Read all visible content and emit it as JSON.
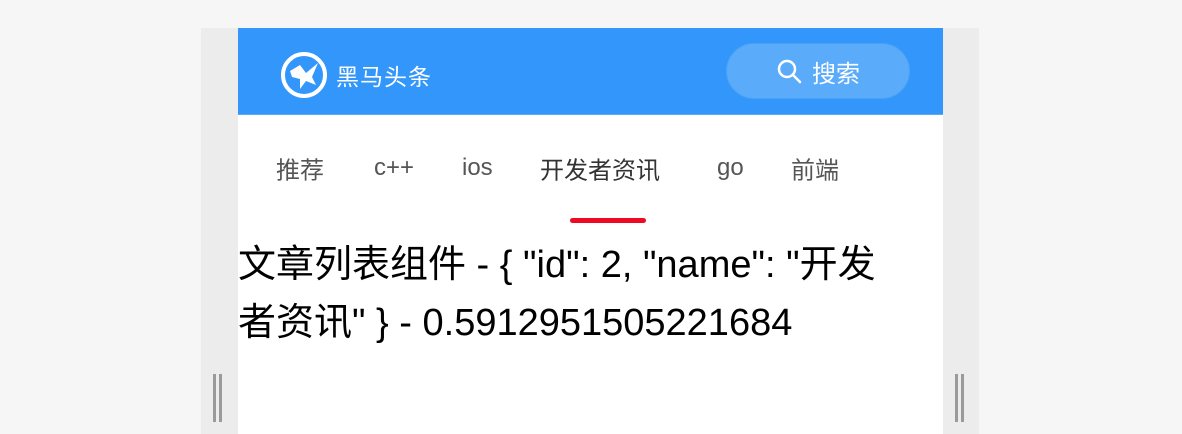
{
  "header": {
    "brand_name": "黑马头条",
    "logo_icon": "horse-logo-icon",
    "search_label": "搜索",
    "search_icon": "search-icon"
  },
  "tabs": [
    {
      "label": "推荐",
      "active": false
    },
    {
      "label": "c++",
      "active": false
    },
    {
      "label": "ios",
      "active": false
    },
    {
      "label": "开发者资讯",
      "active": true
    },
    {
      "label": "go",
      "active": false
    },
    {
      "label": "前端",
      "active": false
    }
  ],
  "article_list": {
    "text": "文章列表组件 - { \"id\": 2, \"name\": \"开发者资讯\" } - 0.5912951505221684"
  },
  "colors": {
    "navbar": "#3296fa",
    "search_button": "#5babfb",
    "active_indicator": "#ee0a24"
  }
}
